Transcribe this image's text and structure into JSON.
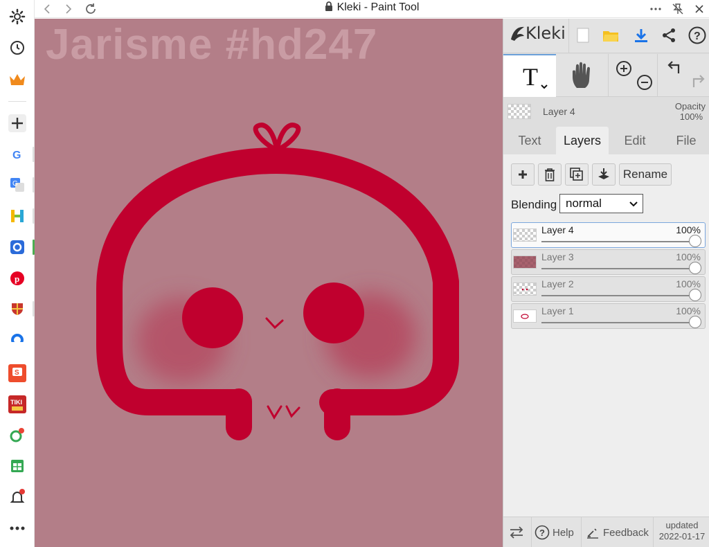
{
  "window": {
    "title": "Kleki - Paint Tool"
  },
  "canvas": {
    "watermark": "Jarisme #hd247",
    "background": "#b37e88",
    "drawing_color": "#c0002e",
    "blush_color": "#b5475e"
  },
  "panel": {
    "logo": "Kleki",
    "current_layer": {
      "name": "Layer 4",
      "opacity_label": "Opacity",
      "opacity_value": "100%"
    },
    "tabs": [
      {
        "label": "Text"
      },
      {
        "label": "Layers"
      },
      {
        "label": "Edit"
      },
      {
        "label": "File"
      }
    ],
    "active_tab": "Layers",
    "layer_buttons": {
      "rename_label": "Rename"
    },
    "blending": {
      "label": "Blending",
      "value": "normal"
    },
    "layers": [
      {
        "name": "Layer 4",
        "opacity": "100%"
      },
      {
        "name": "Layer 3",
        "opacity": "100%"
      },
      {
        "name": "Layer 2",
        "opacity": "100%"
      },
      {
        "name": "Layer 1",
        "opacity": "100%"
      }
    ],
    "footer": {
      "help_label": "Help",
      "feedback_label": "Feedback",
      "updated_label": "updated",
      "updated_date": "2022-01-17"
    }
  }
}
